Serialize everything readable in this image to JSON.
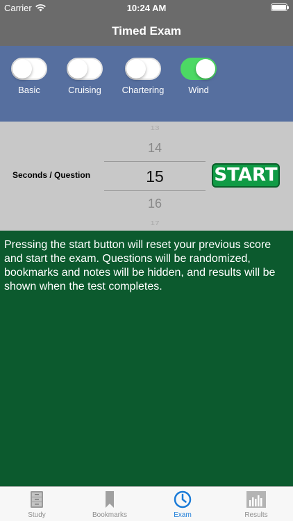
{
  "status_bar": {
    "carrier": "Carrier",
    "time": "10:24 AM",
    "wifi_icon": "wifi-icon",
    "battery_icon": "battery-icon"
  },
  "nav": {
    "title": "Timed Exam"
  },
  "toggles": [
    {
      "label": "Basic",
      "on": false
    },
    {
      "label": "Cruising",
      "on": false
    },
    {
      "label": "Chartering",
      "on": false
    },
    {
      "label": "Wind",
      "on": true
    }
  ],
  "picker": {
    "label": "Seconds / Question",
    "values": [
      "13",
      "14",
      "15",
      "16",
      "17"
    ],
    "selected": "15"
  },
  "start_button": {
    "label": "START"
  },
  "info": {
    "text": "Pressing the start button will reset your previous score and start the exam. Questions will be randomized, bookmarks and notes will be hidden, and results will be shown when the test completes."
  },
  "tabs": [
    {
      "label": "Study",
      "icon": "cabinet-icon",
      "active": false
    },
    {
      "label": "Bookmarks",
      "icon": "bookmark-icon",
      "active": false
    },
    {
      "label": "Exam",
      "icon": "clock-icon",
      "active": true
    },
    {
      "label": "Results",
      "icon": "bar-chart-icon",
      "active": false
    }
  ],
  "colors": {
    "bar_gray": "#6b6b6b",
    "toggle_panel": "#566f9f",
    "picker_panel": "#c8c8c8",
    "info_green": "#0c5a2e",
    "start_green": "#109b45",
    "toggle_on": "#4cd964",
    "tab_active": "#1a7bd8"
  }
}
